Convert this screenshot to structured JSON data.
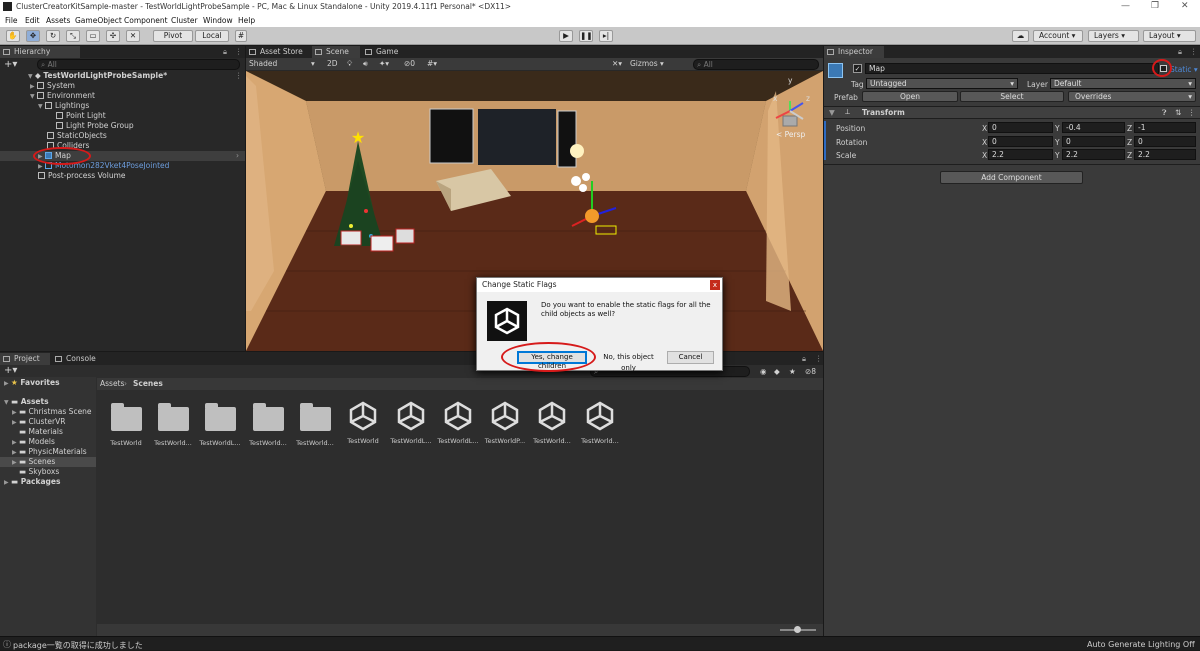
{
  "window": {
    "title": "ClusterCreatorKitSample-master - TestWorldLightProbeSample - PC, Mac & Linux Standalone - Unity 2019.4.11f1 Personal* <DX11>"
  },
  "menu": [
    "File",
    "Edit",
    "Assets",
    "GameObject",
    "Component",
    "Cluster",
    "Window",
    "Help"
  ],
  "toolbar": {
    "pivot": "Pivot",
    "local": "Local",
    "account": "Account",
    "layers": "Layers",
    "layout": "Layout"
  },
  "hierarchy": {
    "tab": "Hierarchy",
    "search": "All",
    "items": [
      "TestWorldLightProbeSample*",
      "System",
      "Environment",
      "Lightings",
      "Point Light",
      "Light Probe Group",
      "StaticObjects",
      "Colliders",
      "Map",
      "Motomon282Vket4PoseJointed",
      "Post-process Volume"
    ]
  },
  "scene": {
    "tabs": [
      "Asset Store",
      "Scene",
      "Game"
    ],
    "shading": "Shaded",
    "mode2d": "2D",
    "fx_count": "0",
    "gizmos": "Gizmos",
    "search": "All",
    "persp": "< Persp",
    "axis_x": "x",
    "axis_y": "y",
    "axis_z": "z"
  },
  "inspector": {
    "tab": "Inspector",
    "name": "Map",
    "static": "Static",
    "tag_label": "Tag",
    "tag": "Untagged",
    "layer_label": "Layer",
    "layer": "Default",
    "prefab_label": "Prefab",
    "prefab_open": "Open",
    "prefab_select": "Select",
    "prefab_overrides": "Overrides",
    "component": "Transform",
    "rows": [
      {
        "label": "Position",
        "x": "0",
        "y": "-0.4",
        "z": "-1"
      },
      {
        "label": "Rotation",
        "x": "0",
        "y": "0",
        "z": "0"
      },
      {
        "label": "Scale",
        "x": "2.2",
        "y": "2.2",
        "z": "2.2"
      }
    ],
    "axis": [
      "X",
      "Y",
      "Z"
    ],
    "add_component": "Add Component"
  },
  "project": {
    "tabs": [
      "Project",
      "Console"
    ],
    "favorites": "Favorites",
    "assets": "Assets",
    "folders": [
      "Christmas Scene",
      "ClusterVR",
      "Materials",
      "Models",
      "PhysicMaterials",
      "Scenes",
      "Skyboxs"
    ],
    "packages": "Packages",
    "breadcrumb": [
      "Assets",
      "Scenes"
    ],
    "items": [
      {
        "name": "TestWorld",
        "kind": "folder"
      },
      {
        "name": "TestWorld...",
        "kind": "folder"
      },
      {
        "name": "TestWorldL...",
        "kind": "folder"
      },
      {
        "name": "TestWorld...",
        "kind": "folder"
      },
      {
        "name": "TestWorld...",
        "kind": "folder"
      },
      {
        "name": "TestWorld",
        "kind": "scene"
      },
      {
        "name": "TestWorldL...",
        "kind": "scene"
      },
      {
        "name": "TestWorldL...",
        "kind": "scene"
      },
      {
        "name": "TestWorldP...",
        "kind": "scene"
      },
      {
        "name": "TestWorld...",
        "kind": "scene"
      },
      {
        "name": "TestWorld...",
        "kind": "scene"
      }
    ],
    "badge": "8"
  },
  "dialog": {
    "title": "Change Static Flags",
    "message": "Do you want to enable the static flags for all the child objects as well?",
    "yes": "Yes, change children",
    "no": "No, this object only",
    "cancel": "Cancel",
    "close": "x"
  },
  "status": {
    "message": "package一覧の取得に成功しました",
    "right": "Auto Generate Lighting Off"
  },
  "colors": {
    "accent": "#2d6bc4",
    "warning_text": "#e86464",
    "highlight_ring": "#d61a1a"
  }
}
